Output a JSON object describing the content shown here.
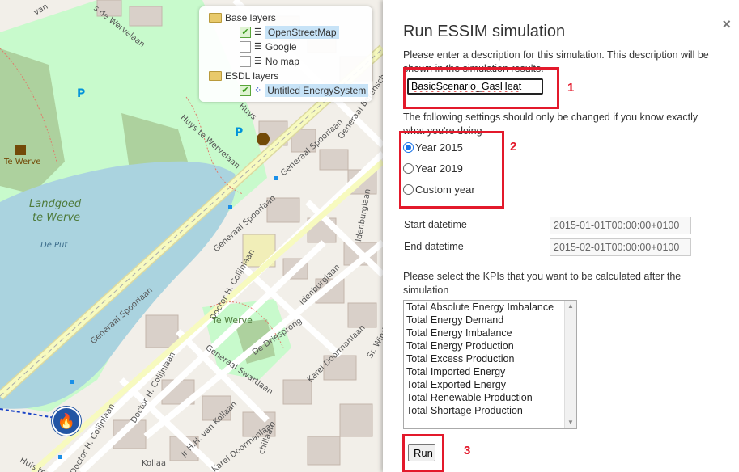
{
  "map": {
    "labels": {
      "te_werve_top": "Te Werve",
      "landgoed_line1": "Landgoed",
      "landgoed_line2": "te Werve",
      "de_put": "De Put",
      "generaal_spoorlaan_1": "Generaal Spoorlaan",
      "generaal_spoorlaan_2": "Generaal Spoorlaan",
      "generaal_spoorlaan_3": "Generaal Spoorlaan",
      "doctor_colijnlaan_1": "Doctor H. Colijnlaan",
      "doctor_colijnlaan_2": "Doctor H. Colijnlaan",
      "doctor_colijnlaan_3": "Doctor H. Colijnlaan",
      "te_werve_mid": "Te Werve",
      "idenburglaan_1": "Idenburglaan",
      "idenburglaan_2": "Idenburglaan",
      "de_driesprong": "De Driesprong",
      "generaal_swartlaan": "Generaal Swartlaan",
      "karel_doormanlaan_1": "Karel Doormanlaan",
      "karel_doormanlaan_2": "Karel Doormanlaan",
      "van_kollaan": "Jr H.H. van Kollaan",
      "huys_te_werve": "Huys te Wervelaan",
      "huys_short": "Huys",
      "generaal_berenschot": "Generaal Berenschot",
      "van_prefix": "van",
      "de_wervelaan_top": "s de Wervelaan",
      "kollaa": "Kollaa",
      "schillaan": "chillaan",
      "huys_te_bottom": "Huis te",
      "sr_wind": "Sr. Wind"
    },
    "layer_panel": {
      "base_group": "Base layers",
      "base_items": [
        "OpenStreetMap",
        "Google",
        "No map"
      ],
      "esdl_group": "ESDL layers",
      "esdl_items": [
        "Untitled EnergySystem"
      ]
    }
  },
  "dialog": {
    "title": "Run ESSIM simulation",
    "description_prompt": "Please enter a description for this simulation. This description will be shown in the simulation results.",
    "description_value": "BasicScenario_GasHeat",
    "settings_warning": "The following settings should only be changed if you know exactly what you're doing",
    "year_options": [
      "Year 2015",
      "Year 2019",
      "Custom year"
    ],
    "selected_year": "Year 2015",
    "start_label": "Start datetime",
    "start_value": "2015-01-01T00:00:00+0100",
    "end_label": "End datetime",
    "end_value": "2015-02-01T00:00:00+0100",
    "kpi_prompt": "Please select the KPIs that you want to be calculated after the simulation",
    "kpis": [
      "Total Absolute Energy Imbalance",
      "Total Energy Demand",
      "Total Energy Imbalance",
      "Total Energy Production",
      "Total Excess Production",
      "Total Imported Energy",
      "Total Exported Energy",
      "Total Renewable Production",
      "Total Shortage Production"
    ],
    "run_label": "Run",
    "close_glyph": "×"
  },
  "annotations": {
    "marker_1": "1",
    "marker_2": "2",
    "marker_3": "3",
    "color": "#e3192b"
  },
  "colors": {
    "water": "#aad3df",
    "park": "#c8facc",
    "wood": "#add19e",
    "road_major": "#f7fabf",
    "building": "#d9d0c9",
    "accent_blue": "#1a73e8"
  }
}
